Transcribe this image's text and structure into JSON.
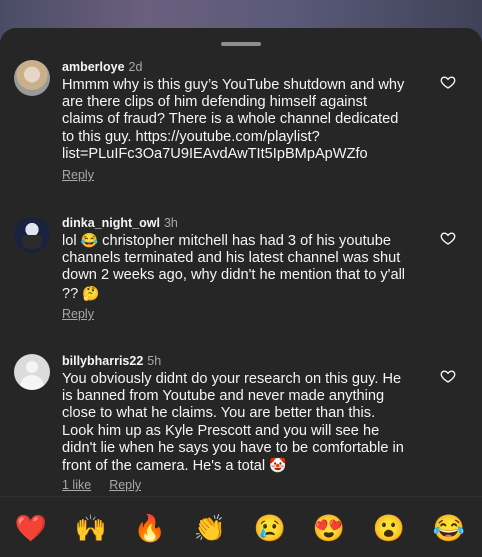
{
  "comments": [
    {
      "username": "amberloye",
      "time": "2d",
      "lines": [
        "Hmmm why is this guy’s YouTube shutdown and why",
        "are there clips of him defending himself against",
        "claims of fraud? There is a whole channel dedicated",
        "to this guy.  https://youtube.com/playlist?",
        "list=PLuIFc3Oa7U9IEAvdAwTIt5IpBMpApWZfo"
      ],
      "reply_label": "Reply"
    },
    {
      "username": "dinka_night_owl",
      "time": "3h",
      "line1_a": "lol",
      "line1_b": "christopher mitchell has had  3  of his youtube",
      "line2": "channels terminated and his latest channel was shut",
      "line3": "down 2 weeks ago, why didn't he mention that to y'all",
      "line4": "??",
      "emoji_laugh": "😂",
      "emoji_think": "🤔",
      "reply_label": "Reply"
    },
    {
      "username": "billybharris22",
      "time": "5h",
      "lines": [
        "You obviously didnt do your research on this guy. He",
        "is banned from Youtube and never made anything",
        "close to what he claims. You are better than this.",
        "Look him up as Kyle Prescott and you will see he",
        "didn't lie when he says you have to be comfortable in"
      ],
      "last_line": "front of the camera. He's a total",
      "emoji_clown": "🤡",
      "likes_label": "1 like",
      "reply_label": "Reply"
    }
  ],
  "reactions": [
    "❤️",
    "🙌",
    "🔥",
    "👏",
    "😢",
    "😍",
    "😮",
    "😂"
  ],
  "colors": {
    "sheet": "#262626",
    "text": "#f5f5f5",
    "secondary": "#a8a8a8"
  }
}
